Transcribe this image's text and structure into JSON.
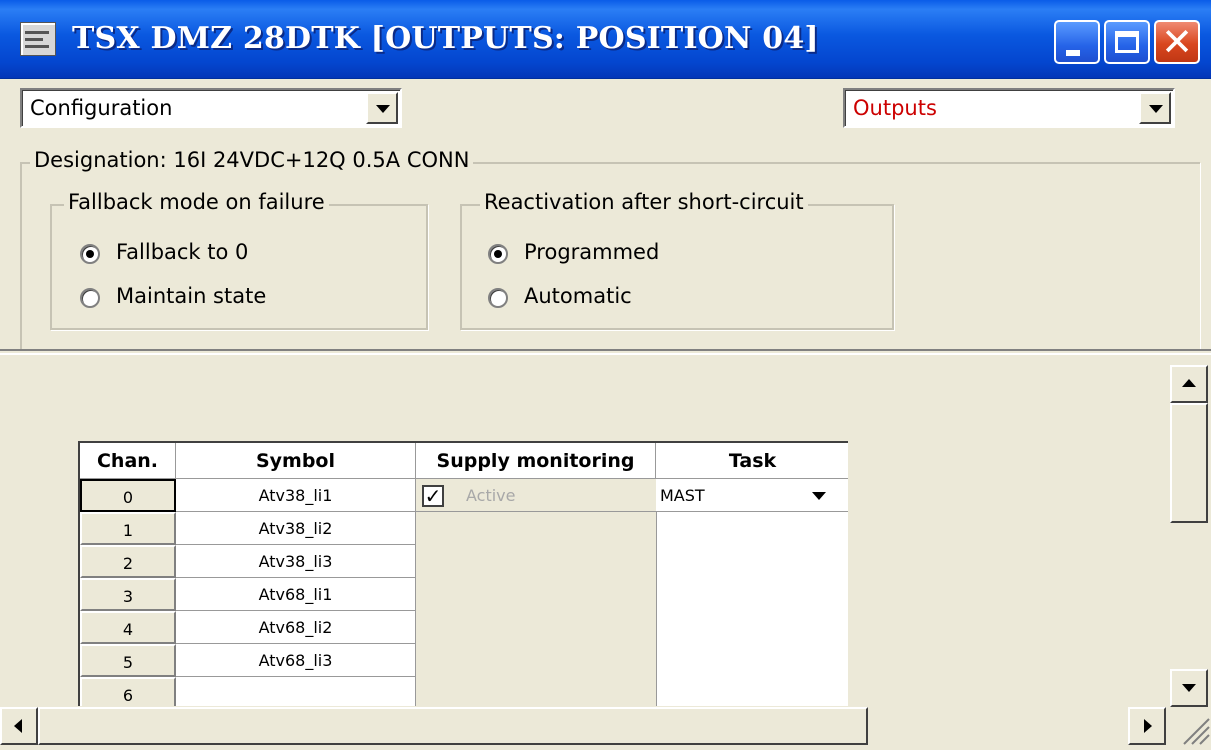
{
  "window": {
    "title": "TSX DMZ 28DTK [OUTPUTS: POSITION 04]",
    "close_glyph": "✕"
  },
  "toolbar": {
    "left_combo": "Configuration",
    "right_combo": "Outputs",
    "right_combo_color": "#cc0000"
  },
  "designation": "Designation: 16I 24VDC+12Q 0.5A CONN",
  "fallback": {
    "legend": "Fallback mode on failure",
    "options": [
      "Fallback to 0",
      "Maintain state"
    ],
    "selected": 0
  },
  "reactivation": {
    "legend": "Reactivation after short-circuit",
    "options": [
      "Programmed",
      "Automatic"
    ],
    "selected": 0
  },
  "table": {
    "headers": [
      "Chan.",
      "Symbol",
      "Supply monitoring",
      "Task"
    ],
    "rows": [
      {
        "chan": "0",
        "symbol": "Atv38_li1"
      },
      {
        "chan": "1",
        "symbol": "Atv38_li2"
      },
      {
        "chan": "2",
        "symbol": "Atv38_li3"
      },
      {
        "chan": "3",
        "symbol": "Atv68_li1"
      },
      {
        "chan": "4",
        "symbol": "Atv68_li2"
      },
      {
        "chan": "5",
        "symbol": "Atv68_li3"
      },
      {
        "chan": "6",
        "symbol": ""
      }
    ],
    "supply_monitoring": {
      "checked": true,
      "label": "Active"
    },
    "task_value": "MAST"
  }
}
